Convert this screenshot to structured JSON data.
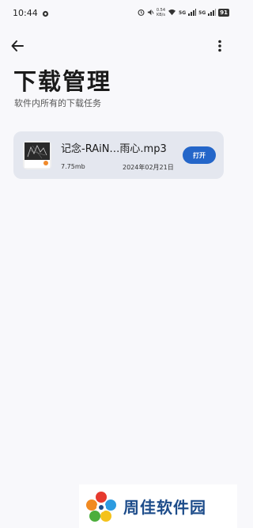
{
  "status_bar": {
    "time": "10:44",
    "network_speed": "0.54\nKB/s",
    "signal_1": "5G",
    "signal_2": "5G",
    "battery": "91"
  },
  "top_bar": {
    "back_icon": "arrow-left-icon",
    "more_icon": "more-vertical-icon"
  },
  "page": {
    "title": "下载管理",
    "subtitle": "软件内所有的下载任务"
  },
  "downloads": [
    {
      "file_name": "记念-RAiN…雨心.mp3",
      "size": "7.75mb",
      "date": "2024年02月21日",
      "open_label": "打开"
    }
  ],
  "watermark": {
    "text": "周佳软件园"
  },
  "colors": {
    "background": "#f8f8fb",
    "card": "#e4e7ef",
    "accent": "#2466c9",
    "watermark_text": "#1d4c8a"
  }
}
